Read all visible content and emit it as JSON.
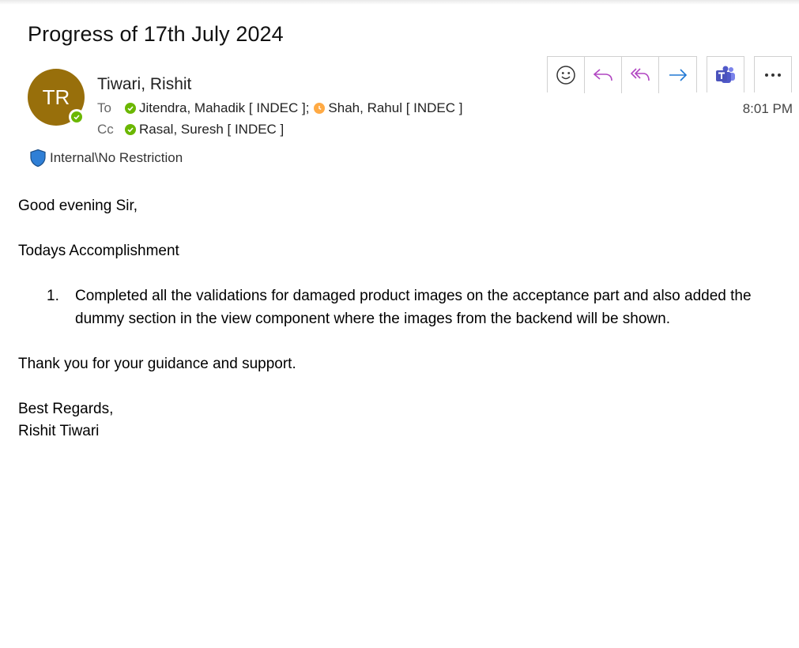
{
  "subject": "Progress of 17th July 2024",
  "sender": {
    "initials": "TR",
    "name": "Tiwari, Rishit",
    "avatar_color": "#986f0b",
    "presence": "available"
  },
  "to": {
    "label": "To",
    "recipients": [
      {
        "name": "Jitendra, Mahadik [ INDEC ];",
        "status": "available"
      },
      {
        "name": "Shah, Rahul [ INDEC ]",
        "status": "away"
      }
    ]
  },
  "cc": {
    "label": "Cc",
    "recipients": [
      {
        "name": "Rasal, Suresh [ INDEC ]",
        "status": "available"
      }
    ]
  },
  "classification": {
    "text": "Internal\\No Restriction",
    "icon": "shield-icon"
  },
  "toolbar": {
    "buttons": [
      "emoji-react-icon",
      "reply-icon",
      "reply-all-icon",
      "forward-icon",
      "teams-icon",
      "more-icon"
    ]
  },
  "time": "8:01 PM",
  "body": {
    "greeting": "Good evening Sir,",
    "heading": "Todays Accomplishment",
    "list": [
      {
        "num": "1.",
        "text": "Completed all the validations for damaged product images on the acceptance part and also added the dummy section in the view component where the images from the backend will be shown."
      }
    ],
    "thanks": "Thank you for your guidance and support.",
    "regards": "Best Regards,",
    "signature": "Rishit Tiwari"
  },
  "colors": {
    "available": "#6bb700",
    "away": "#ffaa44",
    "accent_purple": "#b146c2",
    "accent_blue": "#2078d4",
    "teams": "#4b53bc"
  }
}
